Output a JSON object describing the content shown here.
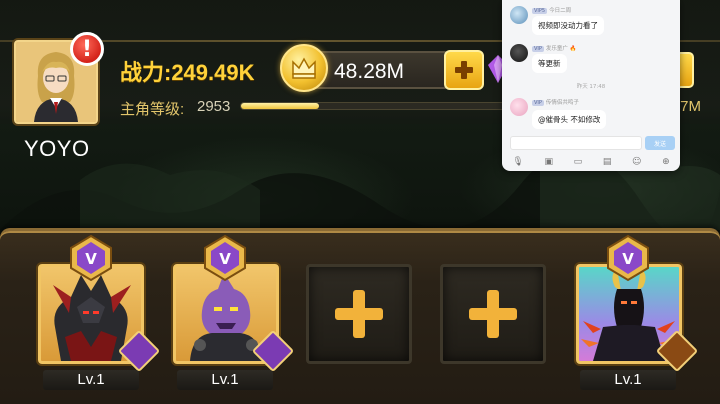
{
  "player": {
    "name": "YOYO",
    "power_label": "战力:249.49K",
    "level_label": "主角等级:",
    "level_value": "2953",
    "xp_progress": 0.27
  },
  "currency": {
    "gold_value": "48.28M",
    "right_value_partial": ".7M"
  },
  "chat": {
    "messages": [
      {
        "tag": "VIP5",
        "name": "",
        "meta": "今日二周",
        "text": "视频即没动力看了"
      },
      {
        "tag": "VIP",
        "name": "",
        "meta": "发乐童广 🔥",
        "text": "等更新"
      },
      {
        "tag": "VIP",
        "name": "",
        "meta": "传情侣共鸣子",
        "text": "@催骨头 不如修改"
      }
    ],
    "time_divider": "昨天 17:48",
    "send_label": "发送",
    "tools": [
      "mic-icon",
      "image-icon",
      "video-icon",
      "file-icon",
      "emoji-icon",
      "add-icon"
    ]
  },
  "heroes": [
    {
      "slot": "slot-1",
      "state": "filled",
      "vip_badge": "V",
      "level": "Lv.1",
      "bg": "gold",
      "faction": "demon"
    },
    {
      "slot": "slot-2",
      "state": "filled",
      "vip_badge": "V",
      "level": "Lv.1",
      "bg": "gold",
      "faction": "demon"
    },
    {
      "slot": "slot-3",
      "state": "empty",
      "vip_badge": "",
      "level": "",
      "bg": "",
      "faction": ""
    },
    {
      "slot": "slot-4",
      "state": "empty",
      "vip_badge": "",
      "level": "",
      "bg": "",
      "faction": ""
    },
    {
      "slot": "slot-5",
      "state": "filled",
      "vip_badge": "V",
      "level": "Lv.1",
      "bg": "teal",
      "faction": "lion"
    }
  ],
  "colors": {
    "accent_gold": "#ffd23a",
    "alert_red": "#d4231a",
    "vip_purple": "#8a48c8"
  }
}
